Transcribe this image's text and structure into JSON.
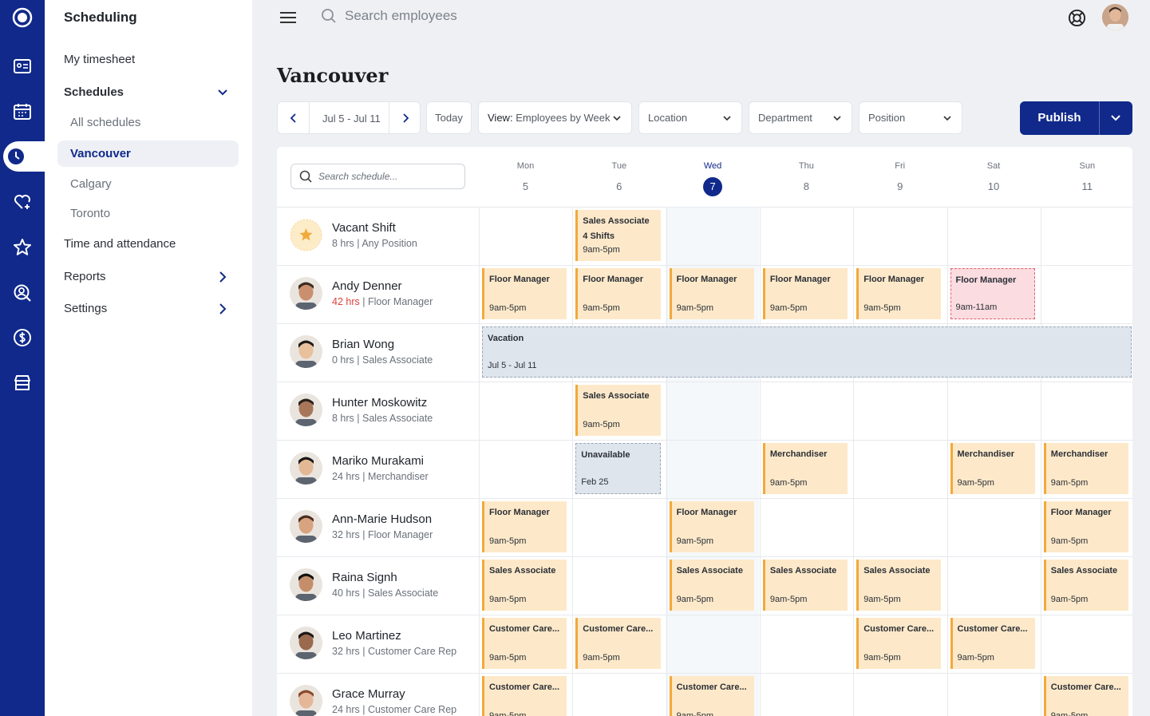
{
  "sidebar": {
    "title": "Scheduling",
    "items": [
      {
        "label": "My timesheet"
      },
      {
        "label": "Schedules"
      },
      {
        "label": "Time and attendance"
      },
      {
        "label": "Reports"
      },
      {
        "label": "Settings"
      }
    ],
    "schedules": [
      {
        "label": "All schedules"
      },
      {
        "label": "Vancouver"
      },
      {
        "label": "Calgary"
      },
      {
        "label": "Toronto"
      }
    ]
  },
  "topbar": {
    "search_placeholder": "Search employees"
  },
  "page": {
    "title": "Vancouver"
  },
  "toolbar": {
    "date_range": "Jul 5 - Jul 11",
    "today": "Today",
    "view_prefix": "View:",
    "view_value": "Employees by Week",
    "location": "Location",
    "department": "Department",
    "position": "Position",
    "publish": "Publish"
  },
  "grid": {
    "search_placeholder": "Search schedule...",
    "days": [
      {
        "name": "Mon",
        "num": "5"
      },
      {
        "name": "Tue",
        "num": "6"
      },
      {
        "name": "Wed",
        "num": "7",
        "today": true
      },
      {
        "name": "Thu",
        "num": "8"
      },
      {
        "name": "Fri",
        "num": "9"
      },
      {
        "name": "Sat",
        "num": "10"
      },
      {
        "name": "Sun",
        "num": "11"
      }
    ],
    "rows": [
      {
        "name": "Vacant Shift",
        "hours": "8 hrs",
        "role": "Any Position"
      },
      {
        "name": "Andy Denner",
        "hours": "42 hrs",
        "role": "Floor Manager",
        "overtime": true
      },
      {
        "name": "Brian Wong",
        "hours": "0 hrs",
        "role": "Sales Associate"
      },
      {
        "name": "Hunter Moskowitz",
        "hours": "8 hrs",
        "role": "Sales Associate"
      },
      {
        "name": "Mariko Murakami",
        "hours": "24 hrs",
        "role": "Merchandiser"
      },
      {
        "name": "Ann-Marie Hudson",
        "hours": "32 hrs",
        "role": "Floor Manager"
      },
      {
        "name": "Raina Signh",
        "hours": "40 hrs",
        "role": "Sales Associate"
      },
      {
        "name": "Leo Martinez",
        "hours": "32 hrs",
        "role": "Customer Care Rep"
      },
      {
        "name": "Grace Murray",
        "hours": "24 hrs",
        "role": "Customer Care Rep"
      }
    ],
    "shifts": {
      "vacant": {
        "role": "Sales Associate",
        "count": "4 Shifts",
        "time": "9am-5pm"
      },
      "fm": "Floor Manager",
      "sa": "Sales Associate",
      "mer": "Merchandiser",
      "cc": "Customer Care...",
      "time": "9am-5pm",
      "short_time": "9am-11am",
      "vacation": "Vacation",
      "vacation_range": "Jul 5 - Jul 11",
      "unavailable": "Unavailable",
      "unavailable_date": "Feb 25"
    }
  },
  "colors": {
    "brand": "#10298a",
    "shift": "#fde9c9",
    "shift_border": "#f2a93b",
    "overtime": "#e0403a"
  }
}
